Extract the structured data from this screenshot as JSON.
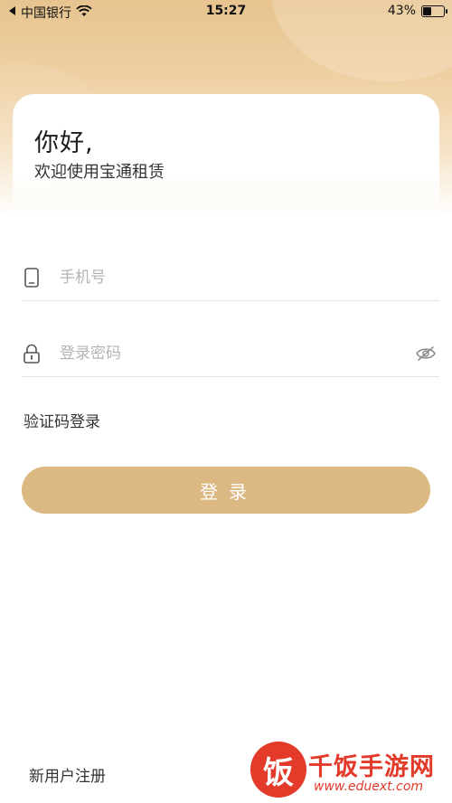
{
  "status_bar": {
    "carrier": "中国银行",
    "time": "15:27",
    "battery_percent": "43%",
    "battery_level": 0.43
  },
  "greeting": {
    "title": "你好,",
    "subtitle": "欢迎使用宝通租赁"
  },
  "form": {
    "phone_placeholder": "手机号",
    "password_placeholder": "登录密码",
    "sms_login_label": "验证码登录",
    "login_button_label": "登录"
  },
  "footer": {
    "register_label": "新用户注册"
  },
  "watermark": {
    "badge_char": "饭",
    "brand_text": "千饭手游网",
    "url": "www.eduext.com"
  },
  "colors": {
    "accent": "#dcb882",
    "header_gradient_top": "#e7c48f",
    "watermark_red": "#e33a2a"
  },
  "icons": {
    "phone": "phone-icon",
    "lock": "lock-icon",
    "eye": "eye-slash-icon",
    "wifi": "wifi-icon",
    "back": "back-arrow-icon"
  }
}
